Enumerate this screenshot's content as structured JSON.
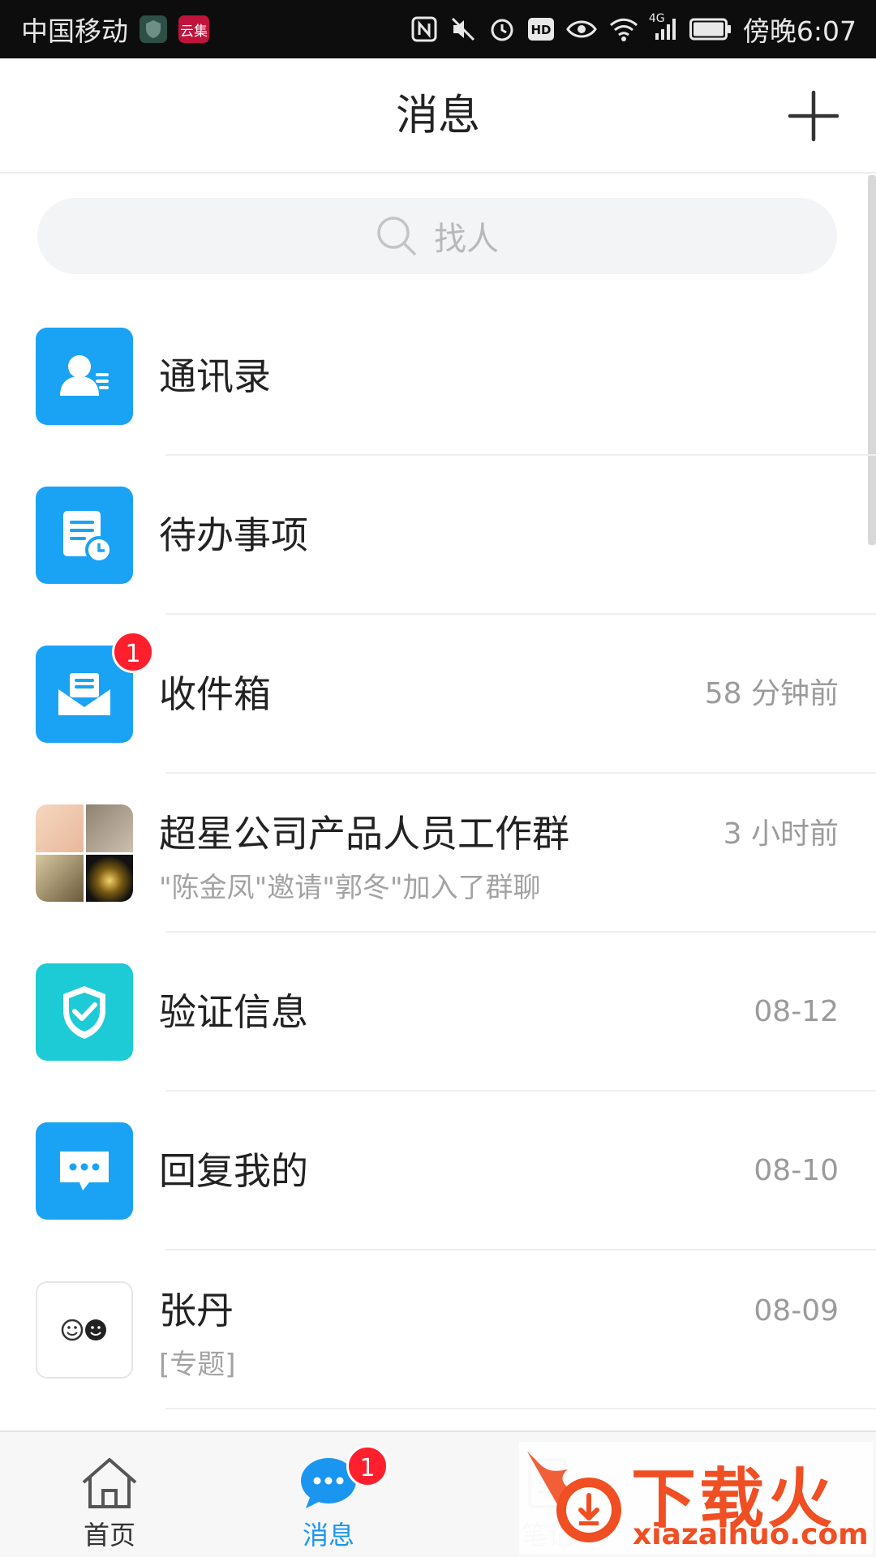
{
  "status_bar": {
    "carrier": "中国移动",
    "carrier_badge": "云集",
    "network": "4G",
    "time": "傍晚6:07"
  },
  "header": {
    "title": "消息"
  },
  "search": {
    "placeholder": "找人"
  },
  "messages": [
    {
      "title": "通讯录",
      "subtitle": "",
      "time": "",
      "icon": "contacts-icon"
    },
    {
      "title": "待办事项",
      "subtitle": "",
      "time": "",
      "icon": "todo-icon"
    },
    {
      "title": "收件箱",
      "subtitle": "",
      "time": "58 分钟前",
      "badge": "1",
      "icon": "inbox-icon"
    },
    {
      "title": "超星公司产品人员工作群",
      "subtitle": "\"陈金凤\"邀请\"郭冬\"加入了群聊",
      "time": "3 小时前",
      "icon": "group-avatar"
    },
    {
      "title": "验证信息",
      "subtitle": "",
      "time": "08-12",
      "icon": "shield-check-icon"
    },
    {
      "title": "回复我的",
      "subtitle": "",
      "time": "08-10",
      "icon": "chat-bubble-icon"
    },
    {
      "title": "张丹",
      "subtitle": "[专题]",
      "time": "08-09",
      "icon": "smiley-avatar"
    }
  ],
  "tabbar": {
    "tabs": [
      {
        "label": "首页",
        "icon": "home-icon"
      },
      {
        "label": "消息",
        "icon": "message-icon",
        "badge": "1",
        "active": true
      },
      {
        "label": "笔记",
        "icon": "note-icon"
      }
    ]
  },
  "watermark": {
    "brand": "下载火",
    "url": "xiazaihuo.com"
  },
  "colors": {
    "accent": "#1a96f0",
    "icon_blue": "#1aa3f5",
    "icon_teal": "#1ccbd6",
    "badge_red": "#ff1f2d"
  }
}
